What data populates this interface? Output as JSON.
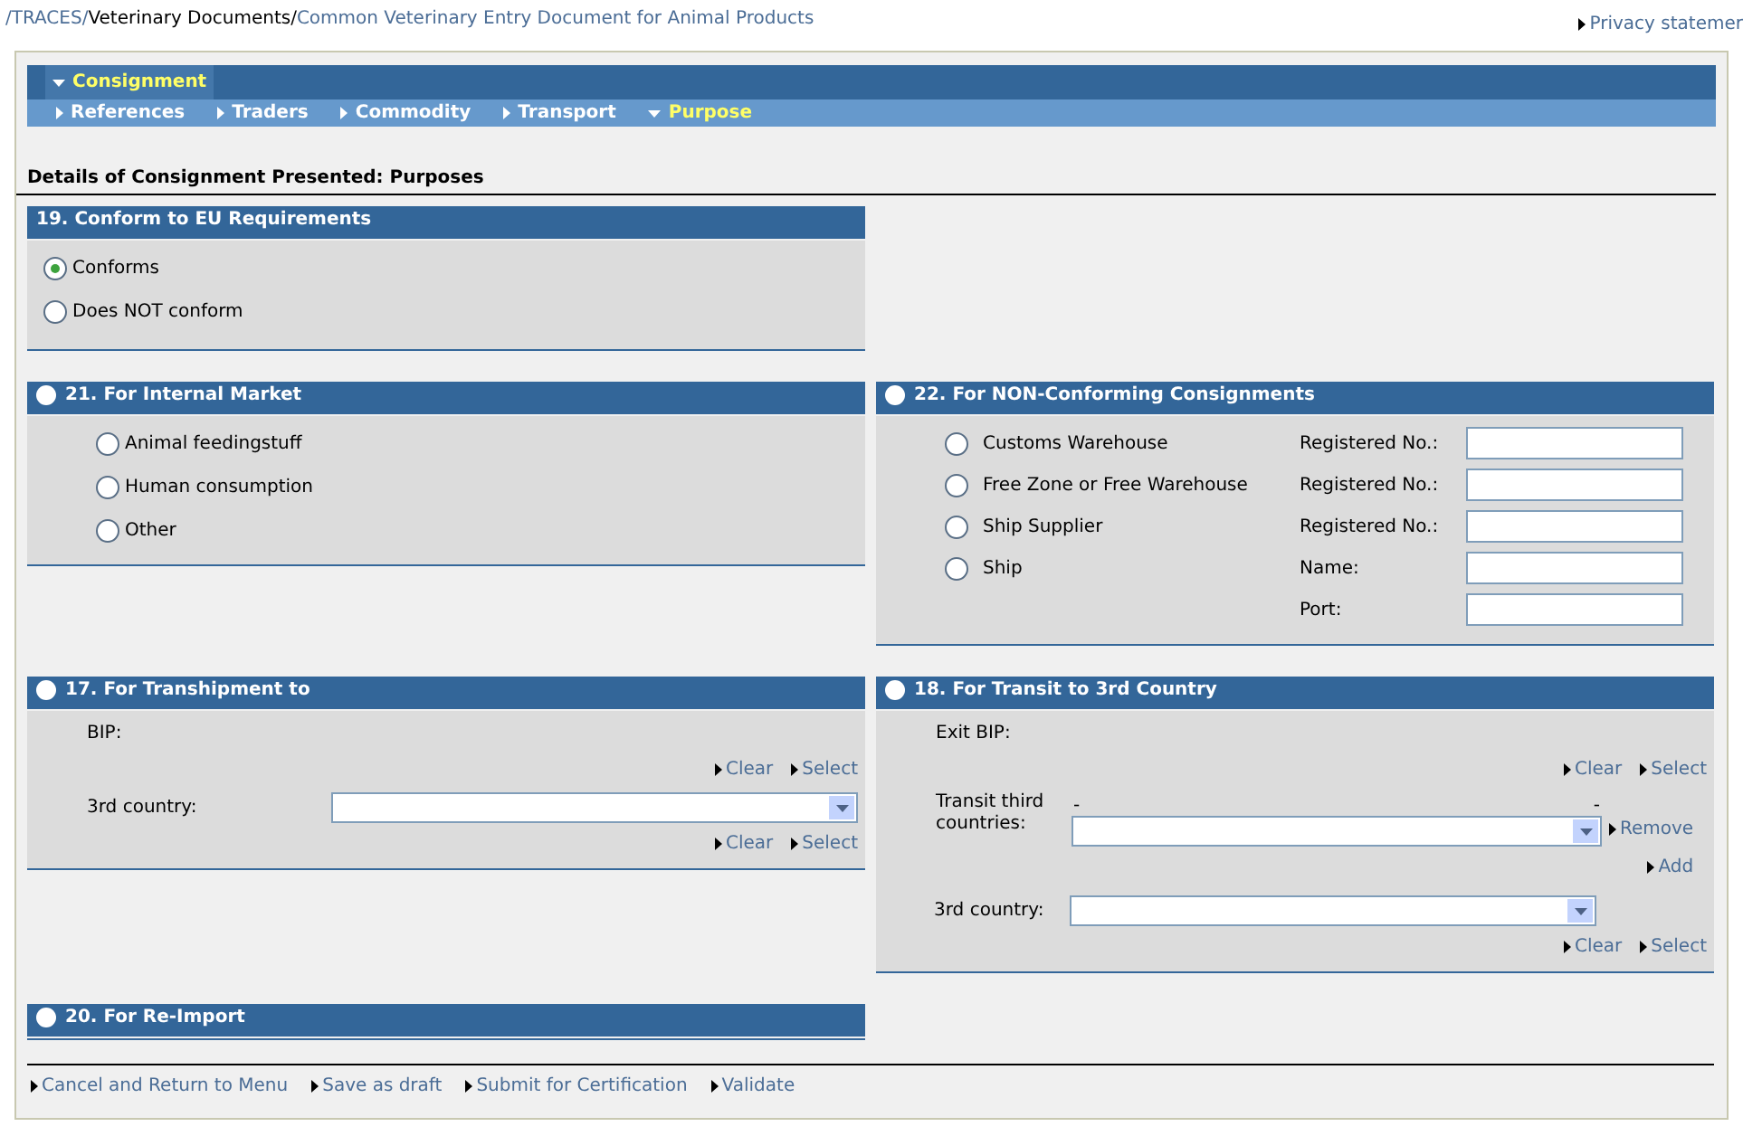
{
  "breadcrumb": [
    {
      "label": "/TRACES/",
      "link": true
    },
    {
      "label": "Veterinary Documents/",
      "link": false
    },
    {
      "label": "Common Veterinary Entry Document for Animal Products",
      "link": true
    }
  ],
  "privacy_link": "Privacy statemer",
  "nav": {
    "main_tab": {
      "label": "Consignment",
      "expanded": true
    },
    "sub_tabs": [
      {
        "label": "References",
        "selected": false
      },
      {
        "label": "Traders",
        "selected": false
      },
      {
        "label": "Commodity",
        "selected": false
      },
      {
        "label": "Transport",
        "selected": false
      },
      {
        "label": "Purpose",
        "selected": true
      }
    ]
  },
  "heading": "Details of Consignment Presented: Purposes",
  "rows": [
    {
      "left": {
        "kind": "radio_list",
        "title": "19. Conform to EU Requirements",
        "options": [
          {
            "label": "Conforms",
            "selected": true
          },
          {
            "label": "Does NOT conform",
            "selected": false
          }
        ]
      }
    },
    {
      "left": {
        "kind": "radio_list",
        "title": "21. For Internal Market",
        "selected": false,
        "options": [
          {
            "label": "Animal feedingstuff",
            "selected": false
          },
          {
            "label": "Human consumption",
            "selected": false
          },
          {
            "label": "Other",
            "selected": false
          }
        ]
      },
      "right": {
        "kind": "non_conforming",
        "title": "22. For NON-Conforming Consignments",
        "selected": false,
        "options": [
          {
            "label": "Customs Warehouse",
            "selected": false
          },
          {
            "label": "Free Zone or Free Warehouse",
            "selected": false
          },
          {
            "label": "Ship Supplier",
            "selected": false
          },
          {
            "label": "Ship",
            "selected": false
          }
        ],
        "fields": [
          {
            "label": "Registered No.:"
          },
          {
            "label": "Registered No.:"
          },
          {
            "label": "Registered No.:"
          },
          {
            "label": "Name:"
          },
          {
            "label": "Port:"
          }
        ]
      }
    },
    {
      "left": {
        "kind": "lookups",
        "title": "17. For Transhipment to",
        "selected": false,
        "fields": [
          {
            "kind": "lookup",
            "label": "BIP:",
            "actions": [
              "Clear",
              "Select"
            ]
          },
          {
            "kind": "dropdown",
            "label": "3rd country:",
            "actions": [
              "Clear",
              "Select"
            ]
          }
        ]
      },
      "right": {
        "kind": "lookups",
        "title": "18. For Transit to 3rd Country",
        "selected": false,
        "fields": [
          {
            "kind": "lookup",
            "label": "Exit BIP:",
            "actions": [
              "Clear",
              "Select"
            ]
          },
          {
            "kind": "list",
            "label": "Transit third countries:",
            "marks": [
              "-",
              "-"
            ],
            "actions": [
              "Remove",
              "Add"
            ]
          },
          {
            "kind": "dropdown",
            "label": "3rd country:",
            "actions": [
              "Clear",
              "Select"
            ]
          }
        ]
      }
    },
    {
      "left": {
        "kind": "empty",
        "title": "20. For Re-Import",
        "selected": false
      }
    }
  ],
  "actions": [
    "Cancel and Return to Menu",
    "Save as draft",
    "Submit for Certification",
    "Validate"
  ]
}
